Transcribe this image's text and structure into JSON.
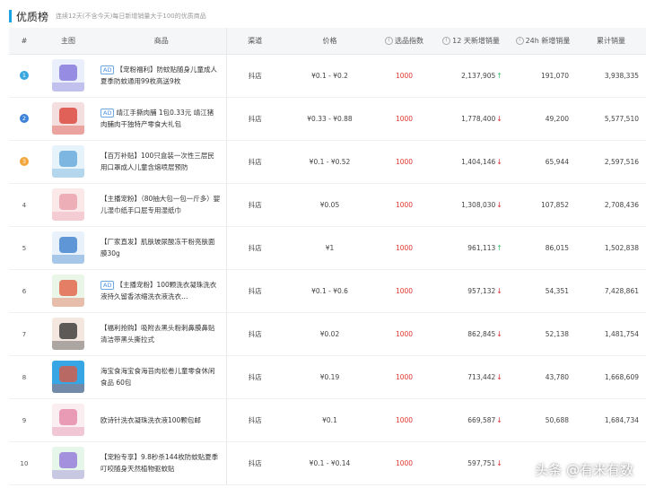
{
  "header": {
    "title": "优质榜",
    "subtitle": "连续12天(不含今天)每日新增销量大于100的优质商品"
  },
  "columns": {
    "rank": "#",
    "image": "主图",
    "product": "商品",
    "channel": "渠道",
    "price": "价格",
    "score": "选品指数",
    "sales12d": "12 天新增销量",
    "sales24h": "24h 新增销量",
    "total": "累计销量"
  },
  "rows": [
    {
      "rank": "1",
      "ad": "AD",
      "title": "【宠粉福利】防蚊贴随身儿童成人夏季防蚊通用99枚高送9枚",
      "channel": "抖店",
      "price": "¥0.1 - ¥0.2",
      "score": "1000",
      "s12": "2,137,905",
      "trend": "up",
      "s24": "191,070",
      "total": "3,938,335",
      "colors": [
        "#e9f0fb",
        "#7a6bd8"
      ]
    },
    {
      "rank": "2",
      "ad": "AD",
      "title": "靖江手撕肉脯 1包0.33元 靖江猪肉脯肉干独特产零食大礼包",
      "channel": "抖店",
      "price": "¥0.33 - ¥0.88",
      "score": "1000",
      "s12": "1,778,400",
      "trend": "down",
      "s24": "49,200",
      "total": "5,577,510",
      "colors": [
        "#f4dede",
        "#d8372b"
      ]
    },
    {
      "rank": "3",
      "ad": "",
      "title": "【百万补贴】100只盒装一次性三层民用口罩成人儿童含熔喷层预防",
      "channel": "抖店",
      "price": "¥0.1 - ¥0.52",
      "score": "1000",
      "s12": "1,404,146",
      "trend": "down",
      "s24": "65,944",
      "total": "2,597,516",
      "colors": [
        "#e7f3fb",
        "#5aa3d8"
      ]
    },
    {
      "rank": "4",
      "ad": "",
      "title": "【主播宠粉】（80抽大包一包一斤多）婴儿湿巾纸手口屁专用湿纸巾",
      "channel": "抖店",
      "price": "¥0.05",
      "score": "1000",
      "s12": "1,308,030",
      "trend": "down",
      "s24": "107,852",
      "total": "2,708,436",
      "colors": [
        "#fbe9ea",
        "#e99aa5"
      ]
    },
    {
      "rank": "5",
      "ad": "",
      "title": "【厂家直发】肌肤玻尿酸冻干粉亮肤面膜30g",
      "channel": "抖店",
      "price": "¥1",
      "score": "1000",
      "s12": "961,113",
      "trend": "up",
      "s24": "86,015",
      "total": "1,502,838",
      "colors": [
        "#e9f2fb",
        "#2f77c9"
      ]
    },
    {
      "rank": "6",
      "ad": "AD",
      "title": "【主播宠粉】100颗洗衣凝珠洗衣液持久留香浓缩洗衣液洗衣…",
      "channel": "抖店",
      "price": "¥0.1 - ¥0.6",
      "score": "1000",
      "s12": "957,132",
      "trend": "down",
      "s24": "54,351",
      "total": "7,428,861",
      "colors": [
        "#eaf6e8",
        "#e2573b"
      ]
    },
    {
      "rank": "7",
      "ad": "",
      "title": "【福利抢购】吸附去黑头粉刺鼻膜鼻贴清洁带黑头撕拉式",
      "channel": "抖店",
      "price": "¥0.02",
      "score": "1000",
      "s12": "862,845",
      "trend": "down",
      "s24": "52,138",
      "total": "1,481,754",
      "colors": [
        "#f3e7e0",
        "#2a2a2a"
      ]
    },
    {
      "rank": "8",
      "ad": "",
      "title": "海宝食海宝食海苔肉松卷儿童零食休闲食品 60包",
      "channel": "抖店",
      "price": "¥0.19",
      "score": "1000",
      "s12": "713,442",
      "trend": "down",
      "s24": "43,780",
      "total": "1,668,609",
      "colors": [
        "#36a7e4",
        "#e6543a"
      ]
    },
    {
      "rank": "9",
      "ad": "",
      "title": "欧诗针洗衣凝珠洗衣液100颗包邮",
      "channel": "抖店",
      "price": "¥0.1",
      "score": "1000",
      "s12": "669,587",
      "trend": "down",
      "s24": "50,688",
      "total": "1,684,734",
      "colors": [
        "#fbeef1",
        "#e37da0"
      ]
    },
    {
      "rank": "10",
      "ad": "",
      "title": "【宠粉专享】9.8秒杀144枚防蚊贴夏季叮咬随身天然植物驱蚊贴",
      "channel": "抖店",
      "price": "¥0.1 - ¥0.14",
      "score": "1000",
      "s12": "597,751",
      "trend": "down",
      "s24": "",
      "total": "",
      "colors": [
        "#e6f7ea",
        "#8e6fd8"
      ]
    }
  ],
  "rank_colors": {
    "1": "#3aa6e0",
    "2": "#3c82d8",
    "3": "#f2a53a"
  },
  "watermark": "头条 @有米有数"
}
